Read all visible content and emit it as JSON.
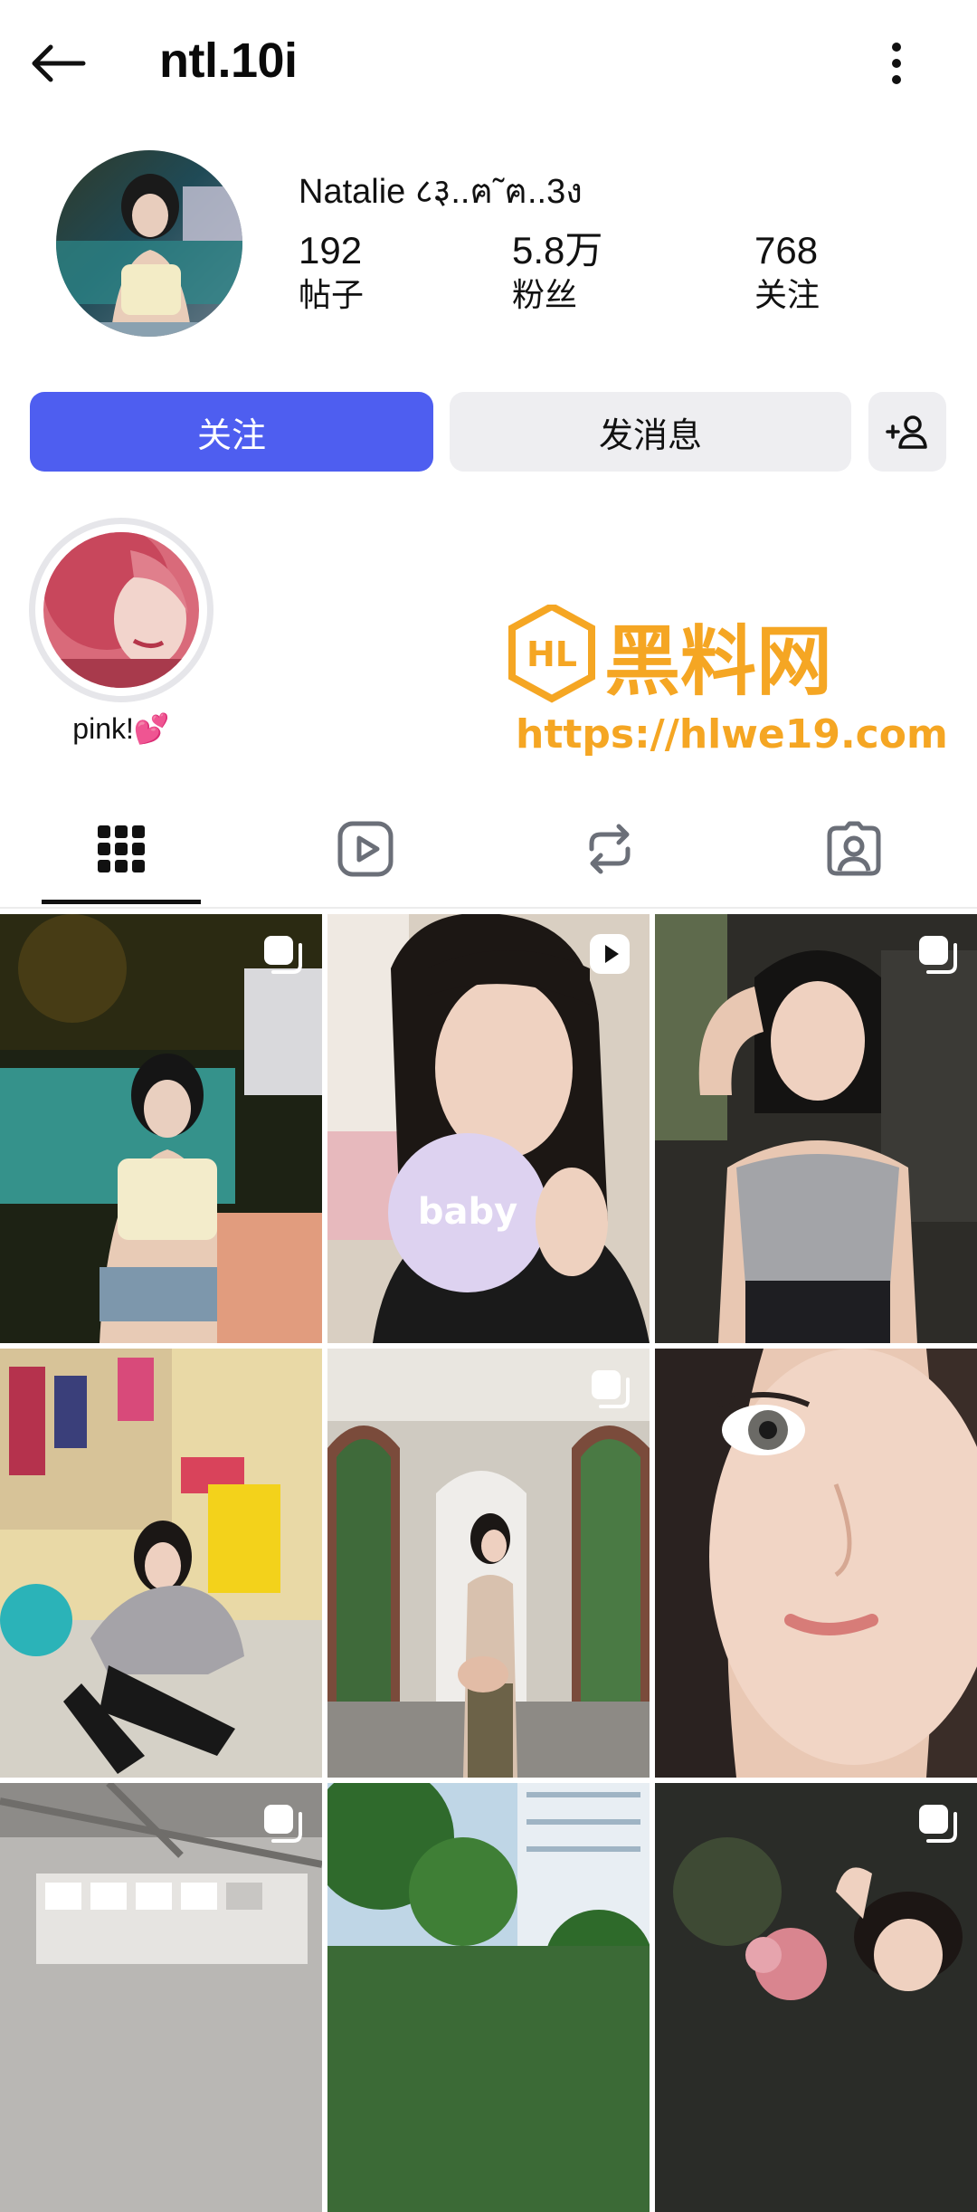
{
  "header": {
    "back_icon": "arrow-left-icon",
    "username": "ntl.10i",
    "more_icon": "more-vertical-icon"
  },
  "profile": {
    "display_name": "Natalie ८३..ฅ˜ฅ..3ง",
    "stats": {
      "posts": {
        "value": "192",
        "label": "帖子"
      },
      "followers": {
        "value": "5.8万",
        "label": "粉丝"
      },
      "following": {
        "value": "768",
        "label": "关注"
      }
    }
  },
  "actions": {
    "follow_label": "关注",
    "message_label": "发消息",
    "add_user_icon": "add-user-icon"
  },
  "highlights": [
    {
      "label": "pink!💕"
    }
  ],
  "watermark": {
    "logo_text": "HL",
    "title": "黑料网",
    "url": "https://hlwe19.com"
  },
  "tabs": [
    {
      "icon": "grid-icon",
      "selected": true
    },
    {
      "icon": "reels-icon",
      "selected": false
    },
    {
      "icon": "repost-icon",
      "selected": false
    },
    {
      "icon": "tagged-icon",
      "selected": false
    }
  ],
  "posts": [
    {
      "badge": "carousel-icon",
      "caption": ""
    },
    {
      "badge": "reel-icon",
      "caption": "baby"
    },
    {
      "badge": "carousel-icon",
      "caption": ""
    },
    {
      "badge": "",
      "caption": ""
    },
    {
      "badge": "carousel-icon",
      "caption": ""
    },
    {
      "badge": "",
      "caption": ""
    },
    {
      "badge": "carousel-icon",
      "caption": ""
    },
    {
      "badge": "",
      "caption": ""
    },
    {
      "badge": "carousel-icon",
      "caption": ""
    }
  ],
  "colors": {
    "follow_button": "#4e5ef0",
    "secondary_button": "#eeeef1",
    "watermark_orange": "#f5a623"
  }
}
